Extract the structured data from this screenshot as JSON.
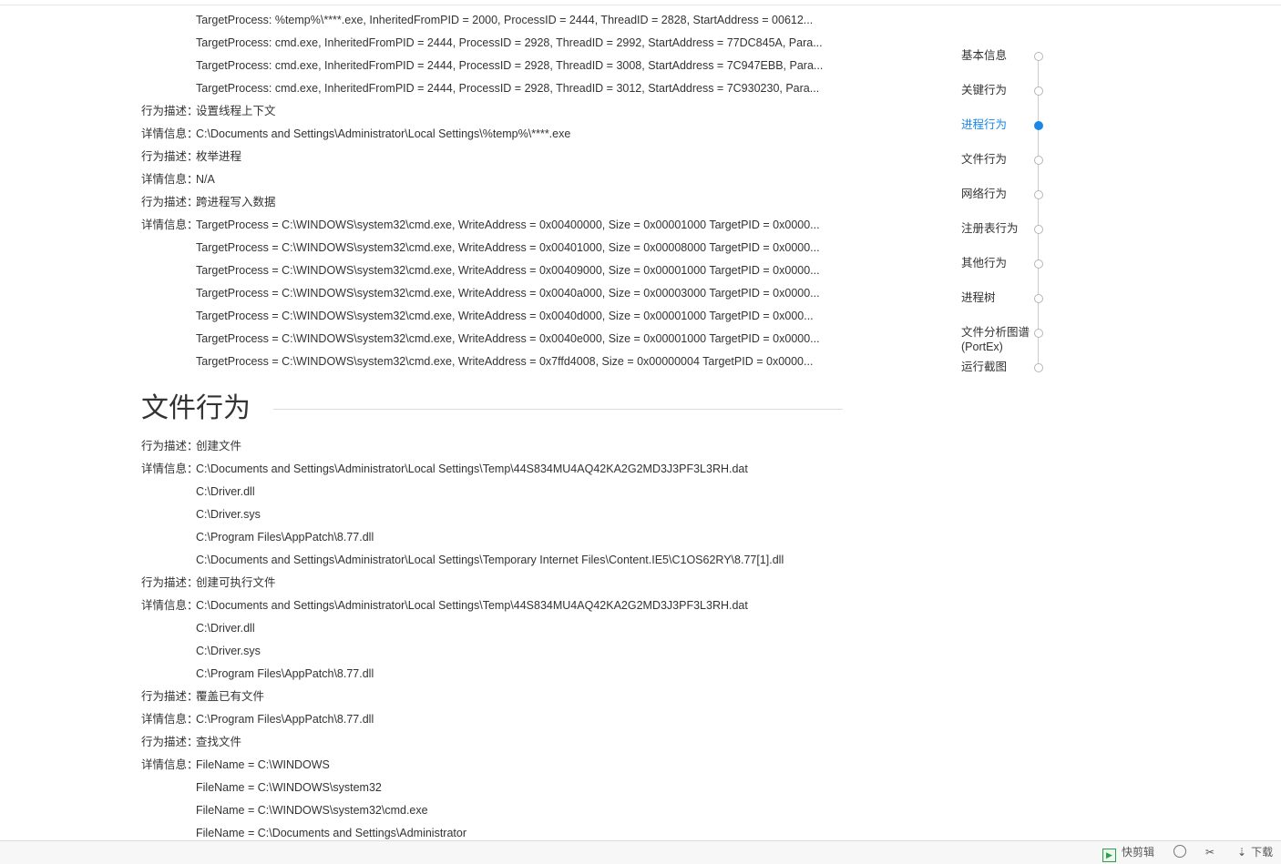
{
  "process_behavior": {
    "continued_lines": [
      "TargetProcess: %temp%\\****.exe, InheritedFromPID = 2000, ProcessID = 2444, ThreadID = 2828, StartAddress = 00612...",
      "TargetProcess: cmd.exe, InheritedFromPID = 2444, ProcessID = 2928, ThreadID = 2992, StartAddress = 77DC845A, Para...",
      "TargetProcess: cmd.exe, InheritedFromPID = 2444, ProcessID = 2928, ThreadID = 3008, StartAddress = 7C947EBB, Para...",
      "TargetProcess: cmd.exe, InheritedFromPID = 2444, ProcessID = 2928, ThreadID = 3012, StartAddress = 7C930230, Para..."
    ],
    "entries": [
      {
        "desc_label": "行为描述：",
        "desc": "设置线程上下文",
        "detail_label": "详情信息：",
        "details": [
          "C:\\Documents and Settings\\Administrator\\Local Settings\\%temp%\\****.exe"
        ]
      },
      {
        "desc_label": "行为描述：",
        "desc": "枚举进程",
        "detail_label": "详情信息：",
        "details": [
          "N/A"
        ]
      },
      {
        "desc_label": "行为描述：",
        "desc": "跨进程写入数据",
        "detail_label": "详情信息：",
        "details": [
          "TargetProcess = C:\\WINDOWS\\system32\\cmd.exe, WriteAddress = 0x00400000, Size = 0x00001000 TargetPID = 0x0000...",
          "TargetProcess = C:\\WINDOWS\\system32\\cmd.exe, WriteAddress = 0x00401000, Size = 0x00008000 TargetPID = 0x0000...",
          "TargetProcess = C:\\WINDOWS\\system32\\cmd.exe, WriteAddress = 0x00409000, Size = 0x00001000 TargetPID = 0x0000...",
          "TargetProcess = C:\\WINDOWS\\system32\\cmd.exe, WriteAddress = 0x0040a000, Size = 0x00003000 TargetPID = 0x0000...",
          "TargetProcess = C:\\WINDOWS\\system32\\cmd.exe, WriteAddress = 0x0040d000, Size = 0x00001000 TargetPID = 0x000...",
          "TargetProcess = C:\\WINDOWS\\system32\\cmd.exe, WriteAddress = 0x0040e000, Size = 0x00001000 TargetPID = 0x0000...",
          "TargetProcess = C:\\WINDOWS\\system32\\cmd.exe, WriteAddress = 0x7ffd4008, Size = 0x00000004 TargetPID = 0x0000..."
        ]
      }
    ]
  },
  "file_behavior": {
    "title": "文件行为",
    "entries": [
      {
        "desc_label": "行为描述：",
        "desc": "创建文件",
        "detail_label": "详情信息：",
        "details": [
          "C:\\Documents and Settings\\Administrator\\Local Settings\\Temp\\44S834MU4AQ42KA2G2MD3J3PF3L3RH.dat",
          "C:\\Driver.dll",
          "C:\\Driver.sys",
          "C:\\Program Files\\AppPatch\\8.77.dll",
          "C:\\Documents and Settings\\Administrator\\Local Settings\\Temporary Internet Files\\Content.IE5\\C1OS62RY\\8.77[1].dll"
        ]
      },
      {
        "desc_label": "行为描述：",
        "desc": "创建可执行文件",
        "detail_label": "详情信息：",
        "details": [
          "C:\\Documents and Settings\\Administrator\\Local Settings\\Temp\\44S834MU4AQ42KA2G2MD3J3PF3L3RH.dat",
          "C:\\Driver.dll",
          "C:\\Driver.sys",
          "C:\\Program Files\\AppPatch\\8.77.dll"
        ]
      },
      {
        "desc_label": "行为描述：",
        "desc": "覆盖已有文件",
        "detail_label": "详情信息：",
        "details": [
          "C:\\Program Files\\AppPatch\\8.77.dll"
        ]
      },
      {
        "desc_label": "行为描述：",
        "desc": "查找文件",
        "detail_label": "详情信息：",
        "details": [
          "FileName = C:\\WINDOWS",
          "FileName = C:\\WINDOWS\\system32",
          "FileName = C:\\WINDOWS\\system32\\cmd.exe",
          "FileName = C:\\Documents and Settings\\Administrator"
        ]
      }
    ]
  },
  "nav": {
    "items": [
      {
        "label": "基本信息",
        "active": false
      },
      {
        "label": "关键行为",
        "active": false
      },
      {
        "label": "进程行为",
        "active": true
      },
      {
        "label": "文件行为",
        "active": false
      },
      {
        "label": "网络行为",
        "active": false
      },
      {
        "label": "注册表行为",
        "active": false
      },
      {
        "label": "其他行为",
        "active": false
      },
      {
        "label": "进程树",
        "active": false
      },
      {
        "label": "文件分析图谱(PortEx)",
        "active": false
      },
      {
        "label": "运行截图",
        "active": false
      }
    ],
    "active_color": "#1a88e5"
  },
  "bottom_bar": {
    "kuaijianji_label": "快剪辑",
    "download_label": "下载"
  }
}
